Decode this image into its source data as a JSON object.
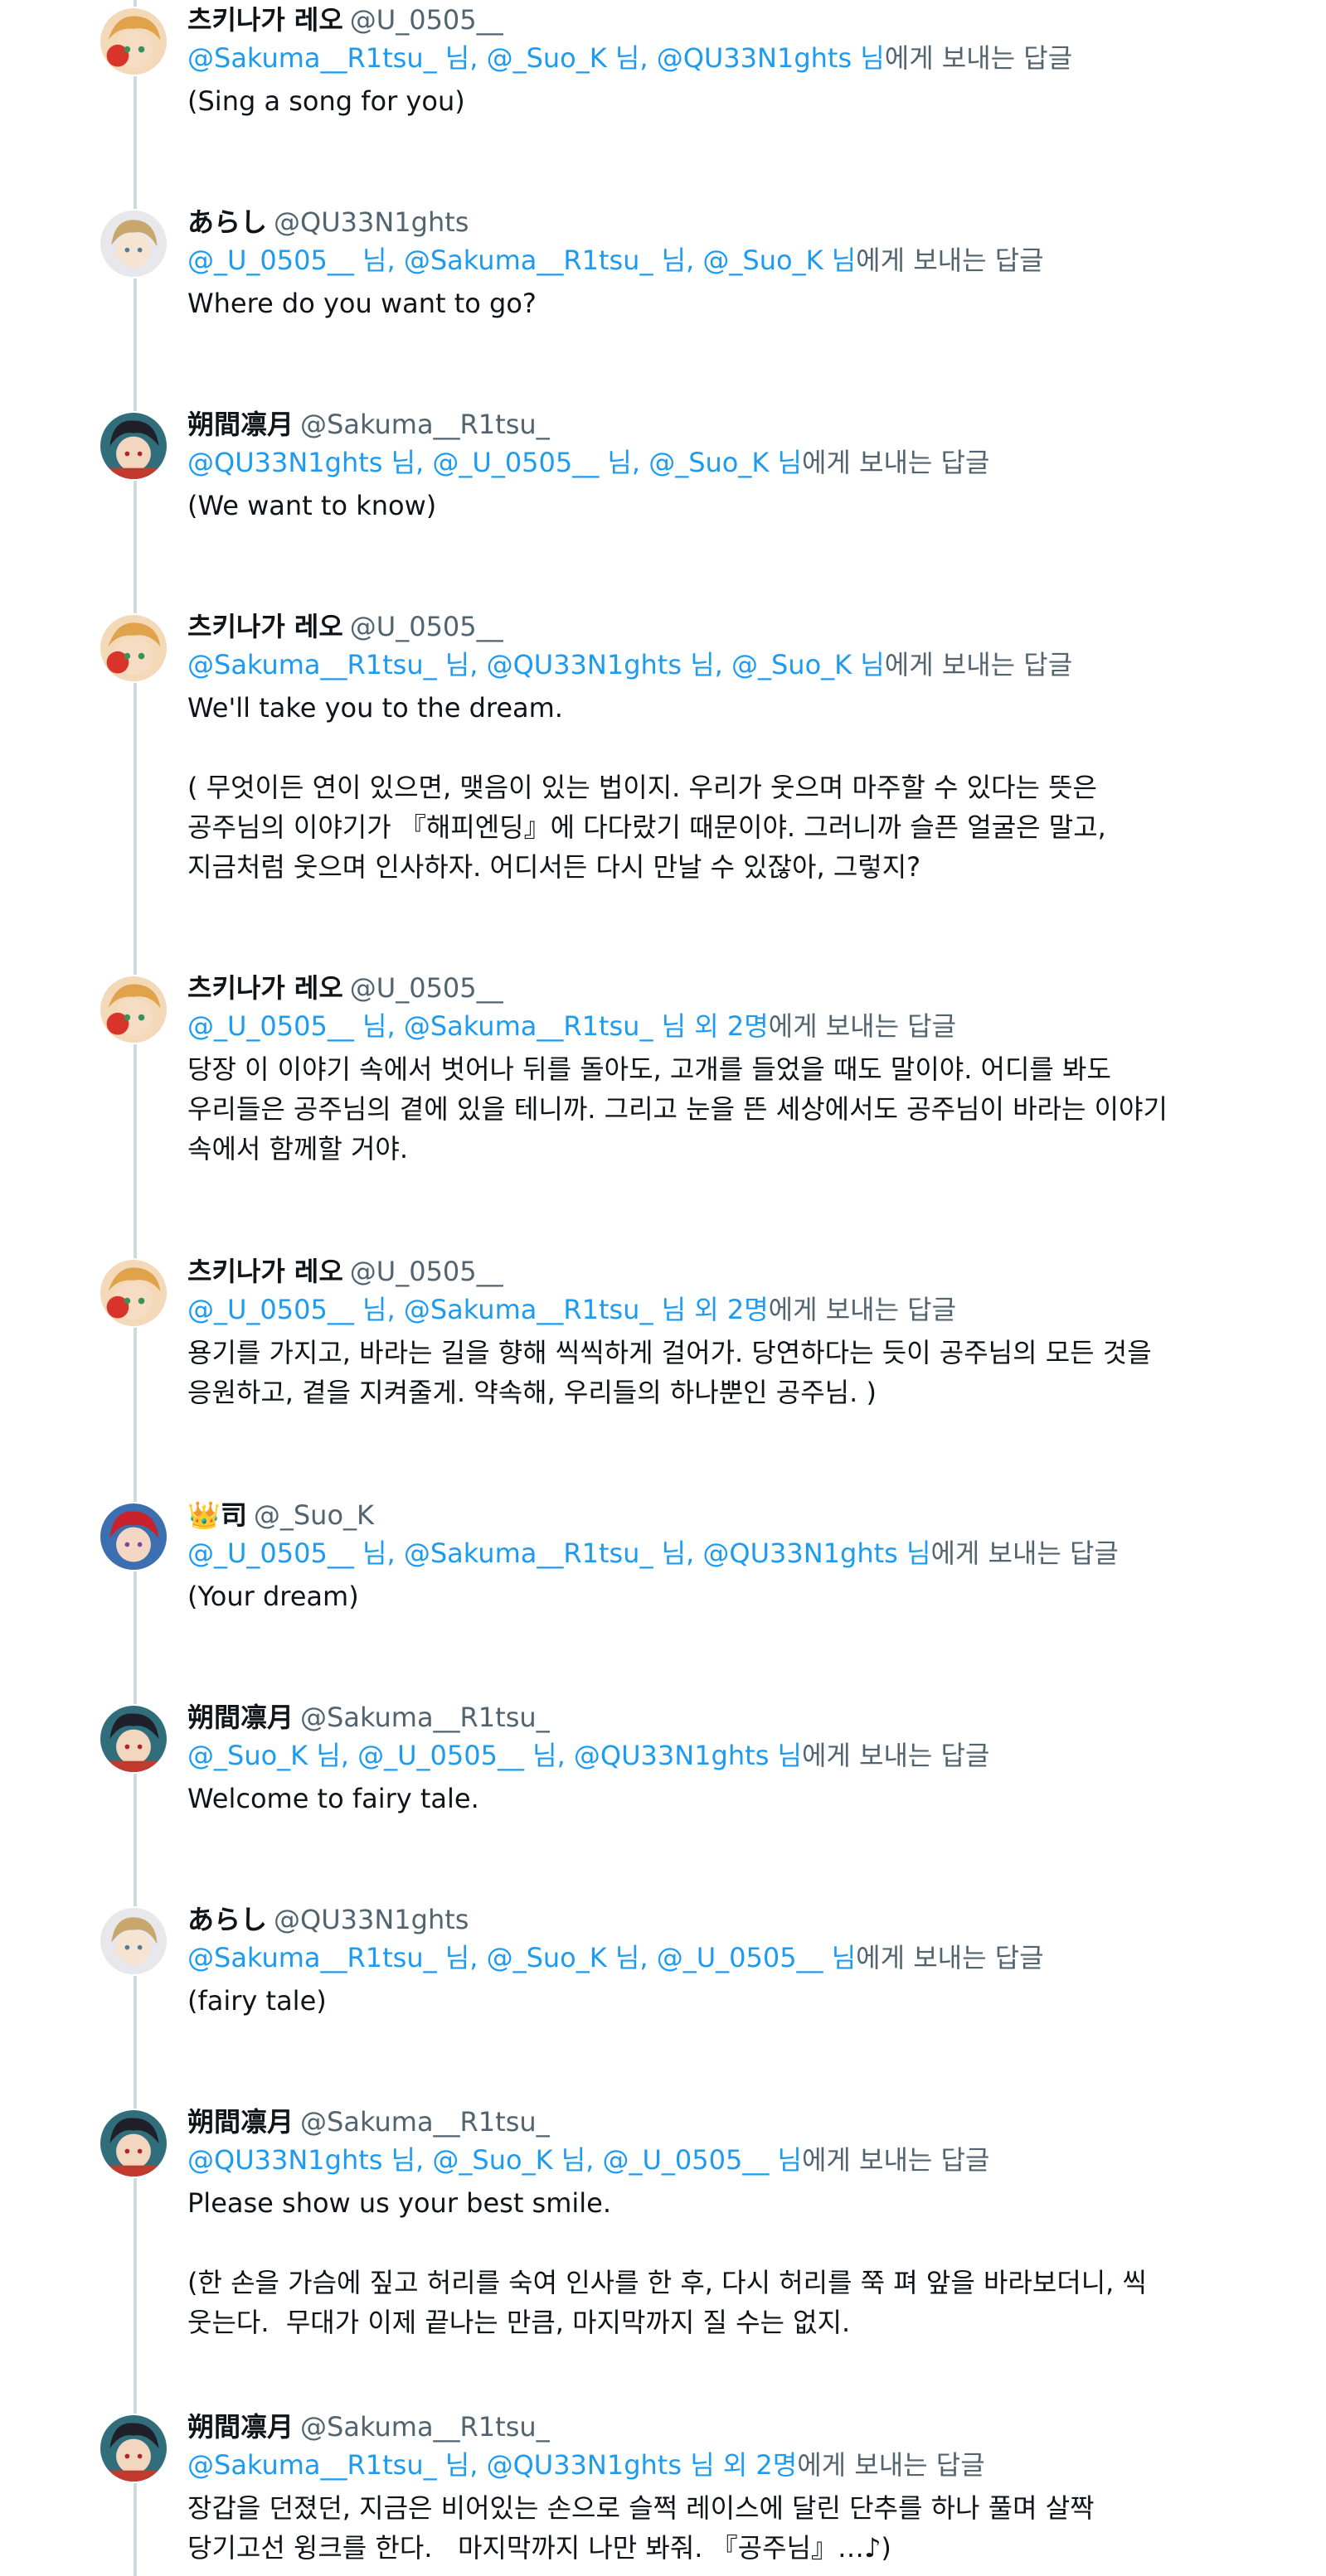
{
  "tweets": [
    {
      "name": "츠키나가 레오",
      "handle": "@U_0505__",
      "mentions": "@Sakuma__R1tsu_ 님, @_Suo_K 님, @QU33N1ghts 님",
      "reply_suffix": "에게 보내는 답글",
      "body": "(Sing a song for you)",
      "avatar": "leo-avatar"
    },
    {
      "name": "あらし",
      "handle": "@QU33N1ghts",
      "mentions": "@_U_0505__ 님, @Sakuma__R1tsu_ 님, @_Suo_K 님",
      "reply_suffix": "에게 보내는 답글",
      "body": "Where do you want to go?",
      "avatar": "arashi-avatar"
    },
    {
      "name": "朔間凛月",
      "handle": "@Sakuma__R1tsu_",
      "mentions": "@QU33N1ghts 님, @_U_0505__ 님, @_Suo_K 님",
      "reply_suffix": "에게 보내는 답글",
      "body": "(We want to know)",
      "avatar": "ritsu-avatar"
    },
    {
      "name": "츠키나가 레오",
      "handle": "@U_0505__",
      "mentions": "@Sakuma__R1tsu_ 님, @QU33N1ghts 님, @_Suo_K 님",
      "reply_suffix": "에게 보내는 답글",
      "body": "We'll take you to the dream.\n\n( 무엇이든 연이 있으면, 맺음이 있는 법이지. 우리가 웃으며 마주할 수 있다는 뜻은\n공주님의 이야기가 『해피엔딩』에 다다랐기 때문이야. 그러니까 슬픈 얼굴은 말고,\n지금처럼 웃으며 인사하자. 어디서든 다시 만날 수 있잖아, 그렇지?",
      "avatar": "leo-avatar"
    },
    {
      "name": "츠키나가 레오",
      "handle": "@U_0505__",
      "mentions": "@_U_0505__ 님, @Sakuma__R1tsu_ 님 외 2명",
      "reply_suffix": "에게 보내는 답글",
      "body": "당장 이 이야기 속에서 벗어나 뒤를 돌아도, 고개를 들었을 때도 말이야. 어디를 봐도\n우리들은 공주님의 곁에 있을 테니까. 그리고 눈을 뜬 세상에서도 공주님이 바라는 이야기\n속에서 함께할 거야.",
      "avatar": "leo-avatar"
    },
    {
      "name": "츠키나가 레오",
      "handle": "@U_0505__",
      "mentions": "@_U_0505__ 님, @Sakuma__R1tsu_ 님 외 2명",
      "reply_suffix": "에게 보내는 답글",
      "body": "용기를 가지고, 바라는 길을 향해 씩씩하게 걸어가. 당연하다는 듯이 공주님의 모든 것을\n응원하고, 곁을 지켜줄게. 약속해, 우리들의 하나뿐인 공주님. )",
      "avatar": "leo-avatar"
    },
    {
      "name": "司",
      "name_prefix": "👑",
      "handle": "@_Suo_K",
      "mentions": "@_U_0505__ 님, @Sakuma__R1tsu_ 님, @QU33N1ghts 님",
      "reply_suffix": "에게 보내는 답글",
      "body": "(Your dream)",
      "avatar": "tsukasa-avatar"
    },
    {
      "name": "朔間凛月",
      "handle": "@Sakuma__R1tsu_",
      "mentions": "@_Suo_K 님, @_U_0505__ 님, @QU33N1ghts 님",
      "reply_suffix": "에게 보내는 답글",
      "body": "Welcome to fairy tale.",
      "avatar": "ritsu-avatar"
    },
    {
      "name": "あらし",
      "handle": "@QU33N1ghts",
      "mentions": "@Sakuma__R1tsu_ 님, @_Suo_K 님, @_U_0505__ 님",
      "reply_suffix": "에게 보내는 답글",
      "body": "(fairy tale)",
      "avatar": "arashi-avatar"
    },
    {
      "name": "朔間凛月",
      "handle": "@Sakuma__R1tsu_",
      "mentions": "@QU33N1ghts 님, @_Suo_K 님, @_U_0505__ 님",
      "reply_suffix": "에게 보내는 답글",
      "body": "Please show us your best smile.\n\n(한 손을 가슴에 짚고 허리를 숙여 인사를 한 후, 다시 허리를 쭉 펴 앞을 바라보더니, 씩\n웃는다.  무대가 이제 끝나는 만큼, 마지막까지 질 수는 없지.",
      "avatar": "ritsu-avatar"
    },
    {
      "name": "朔間凛月",
      "handle": "@Sakuma__R1tsu_",
      "mentions": "@Sakuma__R1tsu_ 님, @QU33N1ghts 님 외 2명",
      "reply_suffix": "에게 보내는 답글",
      "body": "장갑을 던졌던, 지금은 비어있는 손으로 슬쩍 레이스에 달린 단추를 하나 풀며 살짝\n당기고선 윙크를 한다.   마지막까지 나만 봐줘. 『공주님』…♪)",
      "avatar": "ritsu-avatar"
    }
  ]
}
